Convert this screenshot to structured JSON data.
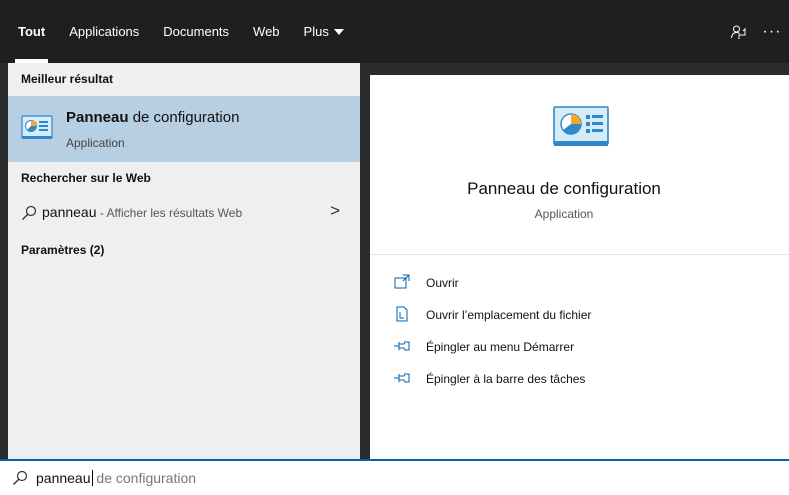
{
  "tabs": [
    {
      "label": "Tout",
      "active": true
    },
    {
      "label": "Applications",
      "active": false
    },
    {
      "label": "Documents",
      "active": false
    },
    {
      "label": "Web",
      "active": false
    },
    {
      "label": "Plus",
      "active": false
    }
  ],
  "topbar": {
    "feedback_icon": "feedback-icon",
    "more_icon": "more-options-icon",
    "more_glyph": "···"
  },
  "results": {
    "best_match_header": "Meilleur résultat",
    "best_match": {
      "title_bold": "Panneau",
      "title_rest": " de configuration",
      "subtitle": "Application",
      "icon": "control-panel-icon"
    },
    "web_header": "Rechercher sur le Web",
    "web_item": {
      "query": "panneau",
      "suffix": " - Afficher les résultats Web",
      "chevron": ">"
    },
    "settings_header": "Paramètres (2)"
  },
  "detail": {
    "title": "Panneau de configuration",
    "subtitle": "Application",
    "icon": "control-panel-icon",
    "actions": [
      {
        "label": "Ouvrir",
        "icon": "open-icon"
      },
      {
        "label": "Ouvrir l’emplacement du fichier",
        "icon": "file-location-icon"
      },
      {
        "label": "Épingler au menu Démarrer",
        "icon": "pin-start-icon"
      },
      {
        "label": "Épingler à la barre des tâches",
        "icon": "pin-taskbar-icon"
      }
    ]
  },
  "search": {
    "typed": "panneau",
    "suggestion": " de configuration"
  },
  "colors": {
    "topbar": "#1f1f1f",
    "selected": "#b7cfe2",
    "accent": "#0063b1"
  }
}
